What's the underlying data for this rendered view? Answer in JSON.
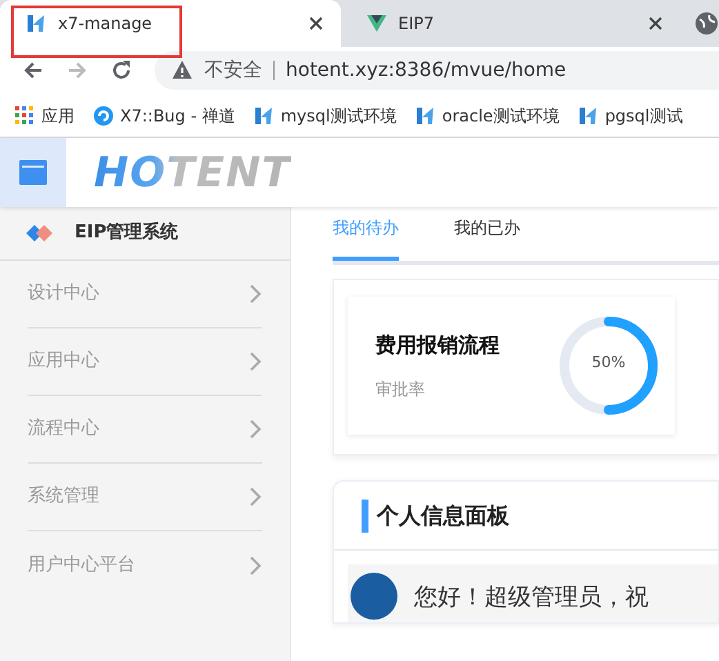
{
  "browser": {
    "tabs": [
      {
        "title": "x7-manage",
        "kind": "hotent",
        "selected": true,
        "highlighted": true
      },
      {
        "title": "EIP7",
        "kind": "vue",
        "selected": false,
        "highlighted": false
      }
    ],
    "address": {
      "security": "不安全",
      "url": "hotent.xyz:8386/mvue/home"
    },
    "bookmarks": [
      {
        "label": "应用",
        "kind": "apps"
      },
      {
        "label": "X7::Bug - 禅道",
        "kind": "zentao"
      },
      {
        "label": "mysql测试环境",
        "kind": "hotent"
      },
      {
        "label": "oracle测试环境",
        "kind": "hotent"
      },
      {
        "label": "pgsql测试",
        "kind": "hotent"
      }
    ]
  },
  "app": {
    "logo": "HOTENT"
  },
  "sidebar": {
    "title": "EIP管理系统",
    "items": [
      {
        "label": "设计中心"
      },
      {
        "label": "应用中心"
      },
      {
        "label": "流程中心"
      },
      {
        "label": "系统管理"
      },
      {
        "label": "用户中心平台"
      }
    ]
  },
  "main": {
    "tabs": [
      {
        "label": "我的待办",
        "selected": true
      },
      {
        "label": "我的已办",
        "selected": false
      }
    ],
    "todo_card": {
      "title": "费用报销流程",
      "subtitle": "审批率",
      "level": 0.5,
      "reading": "50%"
    },
    "info_panel": {
      "title": "个人信息面板",
      "greeting": "您好！超级管理员，祝"
    }
  }
}
